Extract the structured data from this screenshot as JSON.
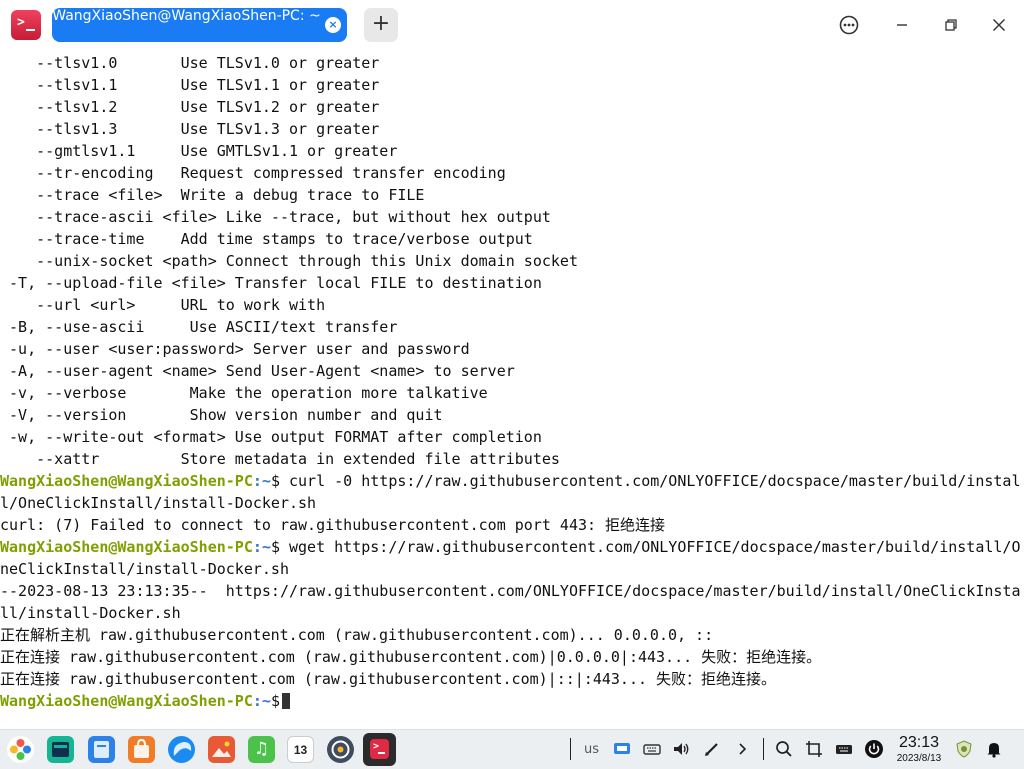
{
  "window": {
    "tab_title": "WangXiaoShen@WangXiaoShen-PC: ~",
    "tab_close": "×",
    "new_tab": "+"
  },
  "terminal": {
    "prompt_user": "WangXiaoShen@WangXiaoShen-PC",
    "prompt_path": ":~",
    "lines": [
      {
        "text": "    --tlsv1.0       Use TLSv1.0 or greater"
      },
      {
        "text": "    --tlsv1.1       Use TLSv1.1 or greater"
      },
      {
        "text": "    --tlsv1.2       Use TLSv1.2 or greater"
      },
      {
        "text": "    --tlsv1.3       Use TLSv1.3 or greater"
      },
      {
        "text": "    --gmtlsv1.1     Use GMTLSv1.1 or greater"
      },
      {
        "text": "    --tr-encoding   Request compressed transfer encoding"
      },
      {
        "text": "    --trace <file>  Write a debug trace to FILE"
      },
      {
        "text": "    --trace-ascii <file> Like --trace, but without hex output"
      },
      {
        "text": "    --trace-time    Add time stamps to trace/verbose output"
      },
      {
        "text": "    --unix-socket <path> Connect through this Unix domain socket"
      },
      {
        "text": " -T, --upload-file <file> Transfer local FILE to destination"
      },
      {
        "text": "    --url <url>     URL to work with"
      },
      {
        "text": " -B, --use-ascii     Use ASCII/text transfer"
      },
      {
        "text": " -u, --user <user:password> Server user and password"
      },
      {
        "text": " -A, --user-agent <name> Send User-Agent <name> to server"
      },
      {
        "text": " -v, --verbose       Make the operation more talkative"
      },
      {
        "text": " -V, --version       Show version number and quit"
      },
      {
        "text": " -w, --write-out <format> Use output FORMAT after completion"
      },
      {
        "text": "    --xattr         Store metadata in extended file attributes"
      },
      {
        "prompt": true,
        "text": "$ curl -0 https://raw.githubusercontent.com/ONLYOFFICE/docspace/master/build/instal"
      },
      {
        "text": "l/OneClickInstall/install-Docker.sh"
      },
      {
        "text": "curl: (7) Failed to connect to raw.githubusercontent.com port 443: 拒绝连接"
      },
      {
        "prompt": true,
        "text": "$ wget https://raw.githubusercontent.com/ONLYOFFICE/docspace/master/build/install/O"
      },
      {
        "text": "neClickInstall/install-Docker.sh"
      },
      {
        "text": "--2023-08-13 23:13:35--  https://raw.githubusercontent.com/ONLYOFFICE/docspace/master/build/install/OneClickInsta"
      },
      {
        "text": "ll/install-Docker.sh"
      },
      {
        "text": "正在解析主机 raw.githubusercontent.com (raw.githubusercontent.com)... 0.0.0.0, ::"
      },
      {
        "text": "正在连接 raw.githubusercontent.com (raw.githubusercontent.com)|0.0.0.0|:443... 失败：拒绝连接。"
      },
      {
        "text": "正在连接 raw.githubusercontent.com (raw.githubusercontent.com)|::|:443... 失败：拒绝连接。"
      },
      {
        "prompt": true,
        "text": "$",
        "cursor": true
      }
    ]
  },
  "dock": {
    "apps": [
      {
        "name": "launcher-icon",
        "color": "#ffffff"
      },
      {
        "name": "multitask-view-icon",
        "color": "#13b592"
      },
      {
        "name": "file-manager-icon",
        "color": "#2c82e8"
      },
      {
        "name": "app-store-icon",
        "color": "#f27b26"
      },
      {
        "name": "browser-icon",
        "color": "#1b8bf2"
      },
      {
        "name": "image-viewer-icon",
        "color": "#e85a36"
      },
      {
        "name": "music-icon",
        "color": "#4cc24a"
      },
      {
        "name": "calendar-icon",
        "color": "#ffffff"
      },
      {
        "name": "settings-icon",
        "color": "#3f4c5e"
      },
      {
        "name": "terminal-icon",
        "color": "#2b2b2b"
      }
    ],
    "calendar_day": "13",
    "keyboard_layout": "us",
    "clock_time": "23:13",
    "clock_date": "2023/8/13"
  },
  "colors": {
    "tab_active": "#1a7cf5",
    "prompt_user": "#7ea000",
    "prompt_path": "#3b73c4",
    "terminal_bg": "#ffffff",
    "app_icon": "#e02a45"
  }
}
